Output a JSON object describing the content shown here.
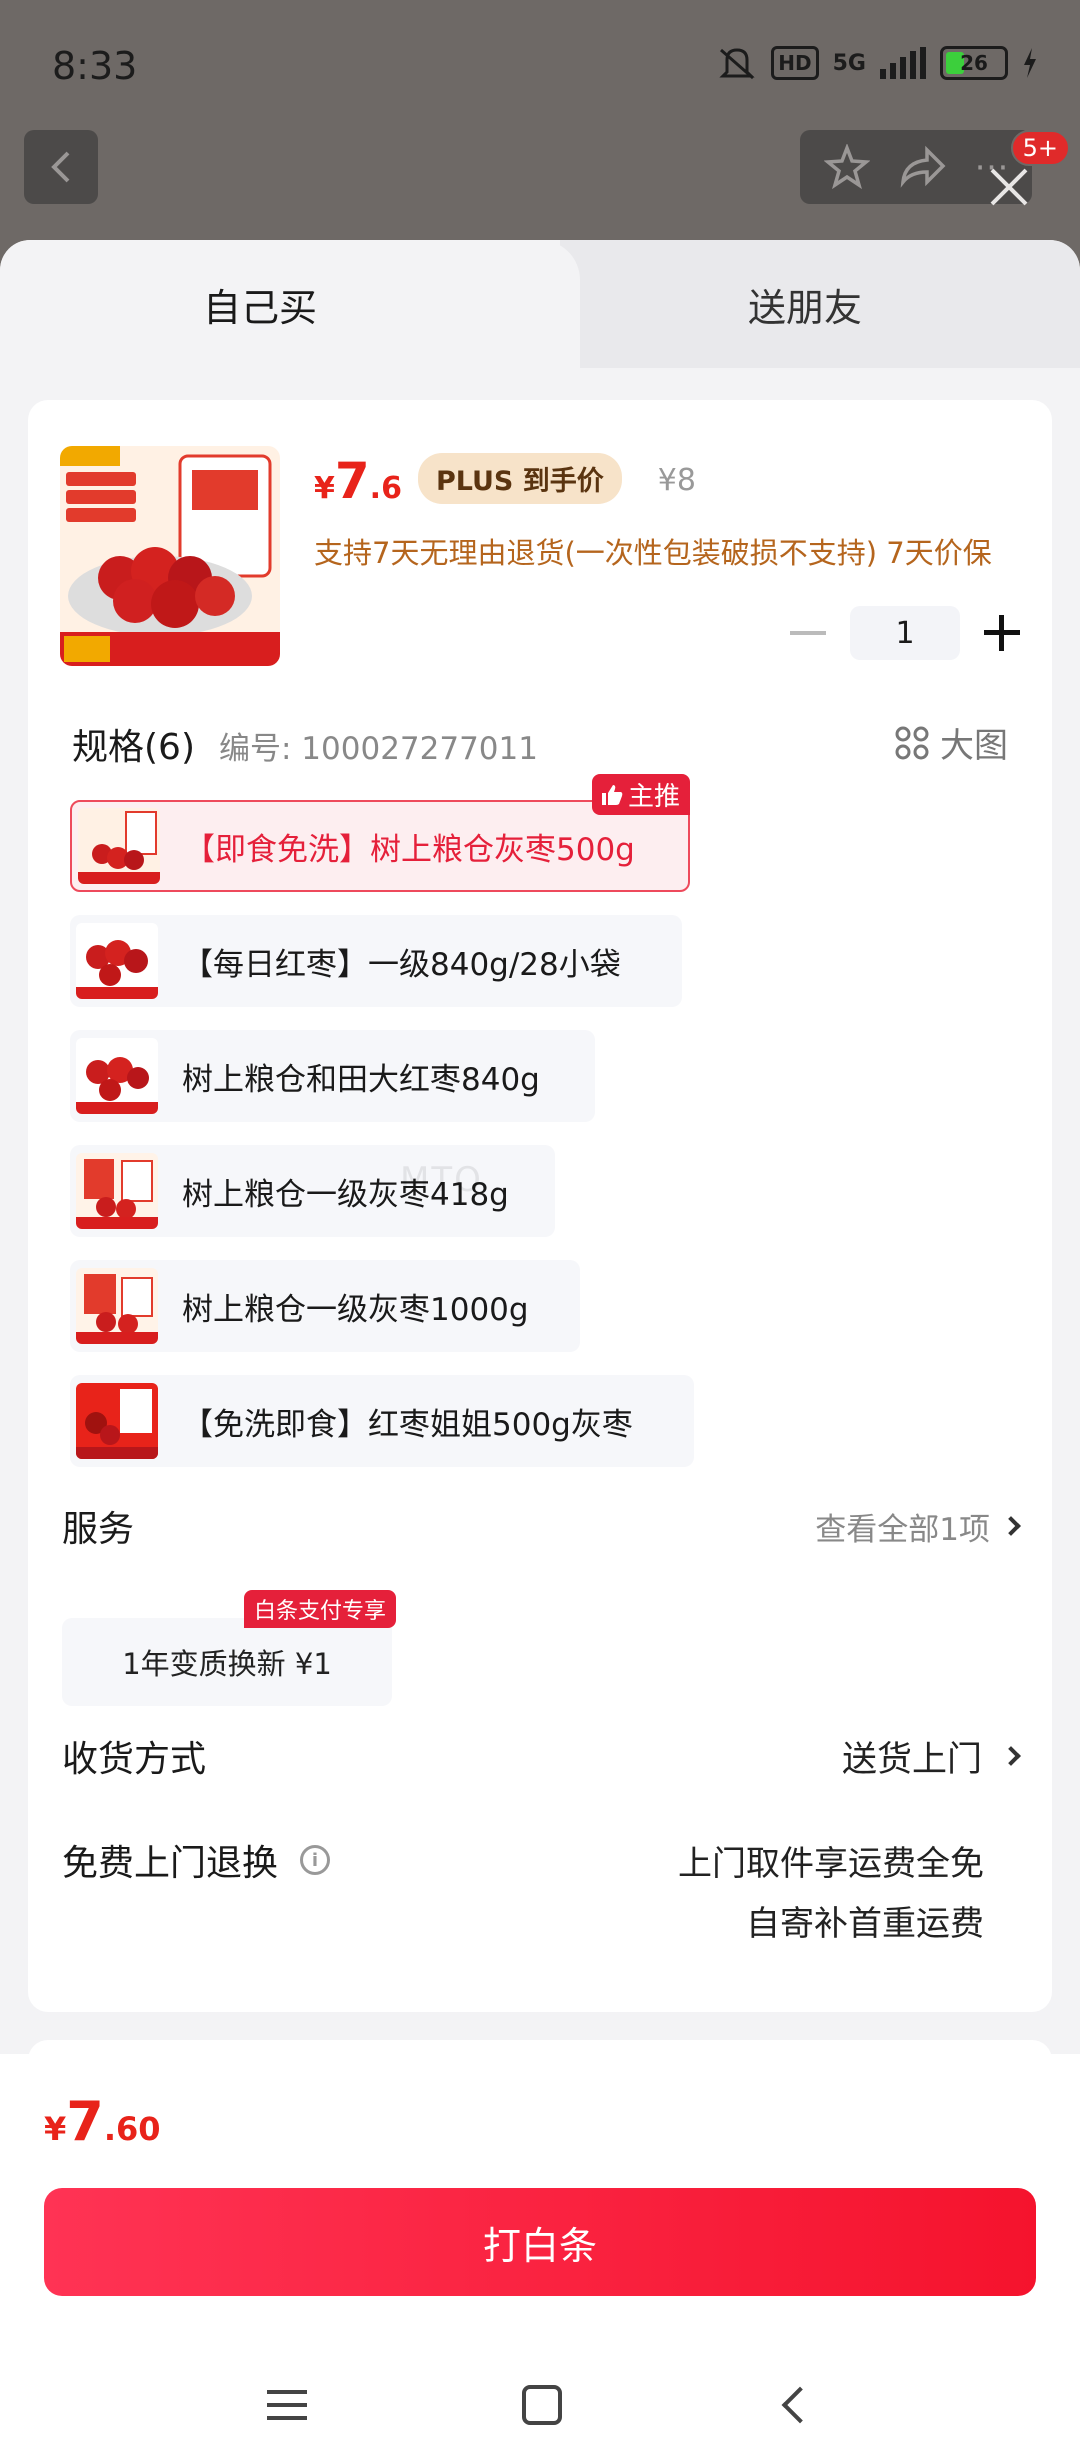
{
  "status_bar": {
    "time": "8:33",
    "hd": "HD",
    "network": "5G",
    "battery": "26"
  },
  "top_bar": {
    "cart_badge": "5+"
  },
  "tabs": [
    {
      "label": "自己买",
      "active": true
    },
    {
      "label": "送朋友",
      "active": false
    }
  ],
  "product": {
    "price_yen": "¥",
    "price_int": "7",
    "price_dec": ".6",
    "plus_label": "PLUS 到手价",
    "original_price": "¥8",
    "support_text": "支持7天无理由退货(一次性包装破损不支持) 7天价保",
    "quantity": "1"
  },
  "spec": {
    "title": "规格(6)",
    "code": "编号: 100027277011",
    "big_image_label": "大图",
    "main_tag": "主推",
    "items": [
      {
        "label": "【即食免洗】树上粮仓灰枣500g",
        "selected": true
      },
      {
        "label": "【每日红枣】一级840g/28小袋",
        "selected": false
      },
      {
        "label": "树上粮仓和田大红枣840g",
        "selected": false
      },
      {
        "label": "树上粮仓一级灰枣418g",
        "selected": false
      },
      {
        "label": "树上粮仓一级灰枣1000g",
        "selected": false
      },
      {
        "label": "【免洗即食】红枣姐姐500g灰枣",
        "selected": false
      }
    ]
  },
  "service": {
    "title": "服务",
    "more": "查看全部1项",
    "item": "1年变质换新  ¥1",
    "tag": "白条支付专享"
  },
  "delivery": {
    "title": "收货方式",
    "value": "送货上门"
  },
  "free_return": {
    "title": "免费上门退换",
    "line1": "上门取件享运费全免",
    "line2": "自寄补首重运费"
  },
  "footer": {
    "total_yen": "¥",
    "total_int": "7",
    "total_dec": ".60",
    "pay_button": "打白条"
  },
  "colors": {
    "accent": "#e8231a",
    "button": "#f5132d",
    "gold_text": "#b5651d"
  }
}
